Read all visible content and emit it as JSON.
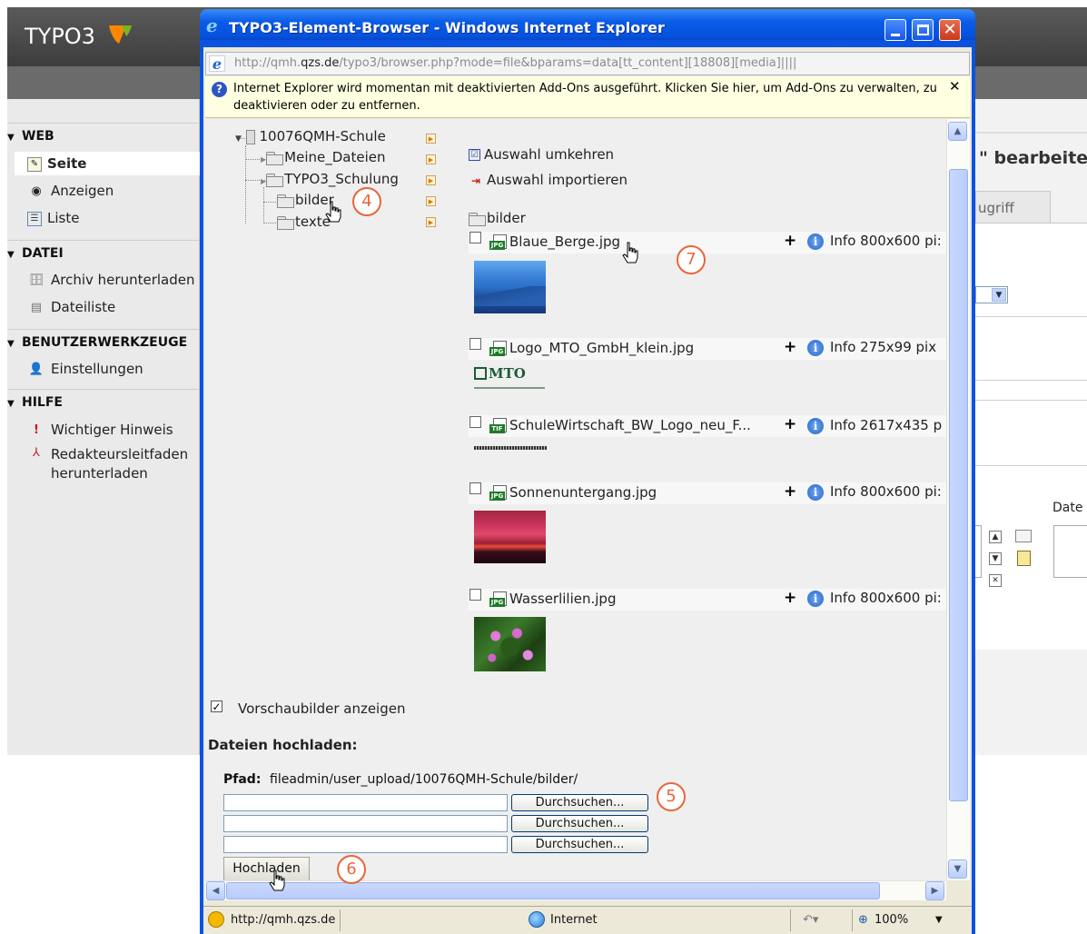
{
  "typo3": {
    "logo": "TYPO3",
    "sidebar": {
      "sections": [
        {
          "label": "WEB",
          "items": [
            {
              "label": "Seite"
            },
            {
              "label": "Anzeigen"
            },
            {
              "label": "Liste"
            }
          ]
        },
        {
          "label": "DATEI",
          "items": [
            {
              "label": "Archiv herunterladen"
            },
            {
              "label": "Dateiliste"
            }
          ]
        },
        {
          "label": "BENUTZERWERKZEUGE",
          "items": [
            {
              "label": "Einstellungen"
            }
          ]
        },
        {
          "label": "HILFE",
          "items": [
            {
              "label": "Wichtiger Hinweis"
            },
            {
              "label": "Redakteursleitfaden herunterladen"
            }
          ]
        }
      ]
    },
    "main": {
      "title_fragment": "\" bearbeite",
      "tab_fragment": "ugriff",
      "dat_fragment": "Date"
    }
  },
  "ie": {
    "title": "TYPO3-Element-Browser - Windows Internet Explorer",
    "address_prefix": "http://qmh.",
    "address_domain": "qzs.de",
    "address_suffix": "/typo3/browser.php?mode=file&bparams=data[tt_content][18808][media]||||",
    "info_bar": "Internet Explorer wird momentan mit deaktivierten Add-Ons ausgeführt. Klicken Sie hier, um Add-Ons zu verwalten, zu deaktivieren oder zu entfernen.",
    "status": {
      "url": "http://qmh.qzs.de",
      "zone": "Internet",
      "zoom": "100%"
    }
  },
  "tree": {
    "root": "10076QMH-Schule",
    "folders": [
      "Meine_Dateien",
      "TYPO3_Schulung",
      "bilder",
      "texte"
    ]
  },
  "browser": {
    "cmd_invert": "Auswahl umkehren",
    "cmd_import": "Auswahl importieren",
    "current_folder": "bilder",
    "files": [
      {
        "name": "Blaue_Berge.jpg",
        "type": "JPG",
        "info": "Info 800x600 pi:"
      },
      {
        "name": "Logo_MTO_GmbH_klein.jpg",
        "type": "JPG",
        "info": "Info 275x99 pix"
      },
      {
        "name": "SchuleWirtschaft_BW_Logo_neu_F...",
        "type": "TIF",
        "info": "Info 2617x435 p"
      },
      {
        "name": "Sonnenuntergang.jpg",
        "type": "JPG",
        "info": "Info 800x600 pi:"
      },
      {
        "name": "Wasserlilien.jpg",
        "type": "JPG",
        "info": "Info 800x600 pi:"
      }
    ],
    "mto_logo_text": "MTO",
    "show_thumbs_label": "Vorschaubilder anzeigen",
    "upload_title": "Dateien hochladen:",
    "path_label": "Pfad:",
    "path_value": "fileadmin/user_upload/10076QMH-Schule/bilder/",
    "browse_label": "Durchsuchen...",
    "upload_button": "Hochladen"
  },
  "callouts": [
    "4",
    "5",
    "6",
    "7"
  ]
}
